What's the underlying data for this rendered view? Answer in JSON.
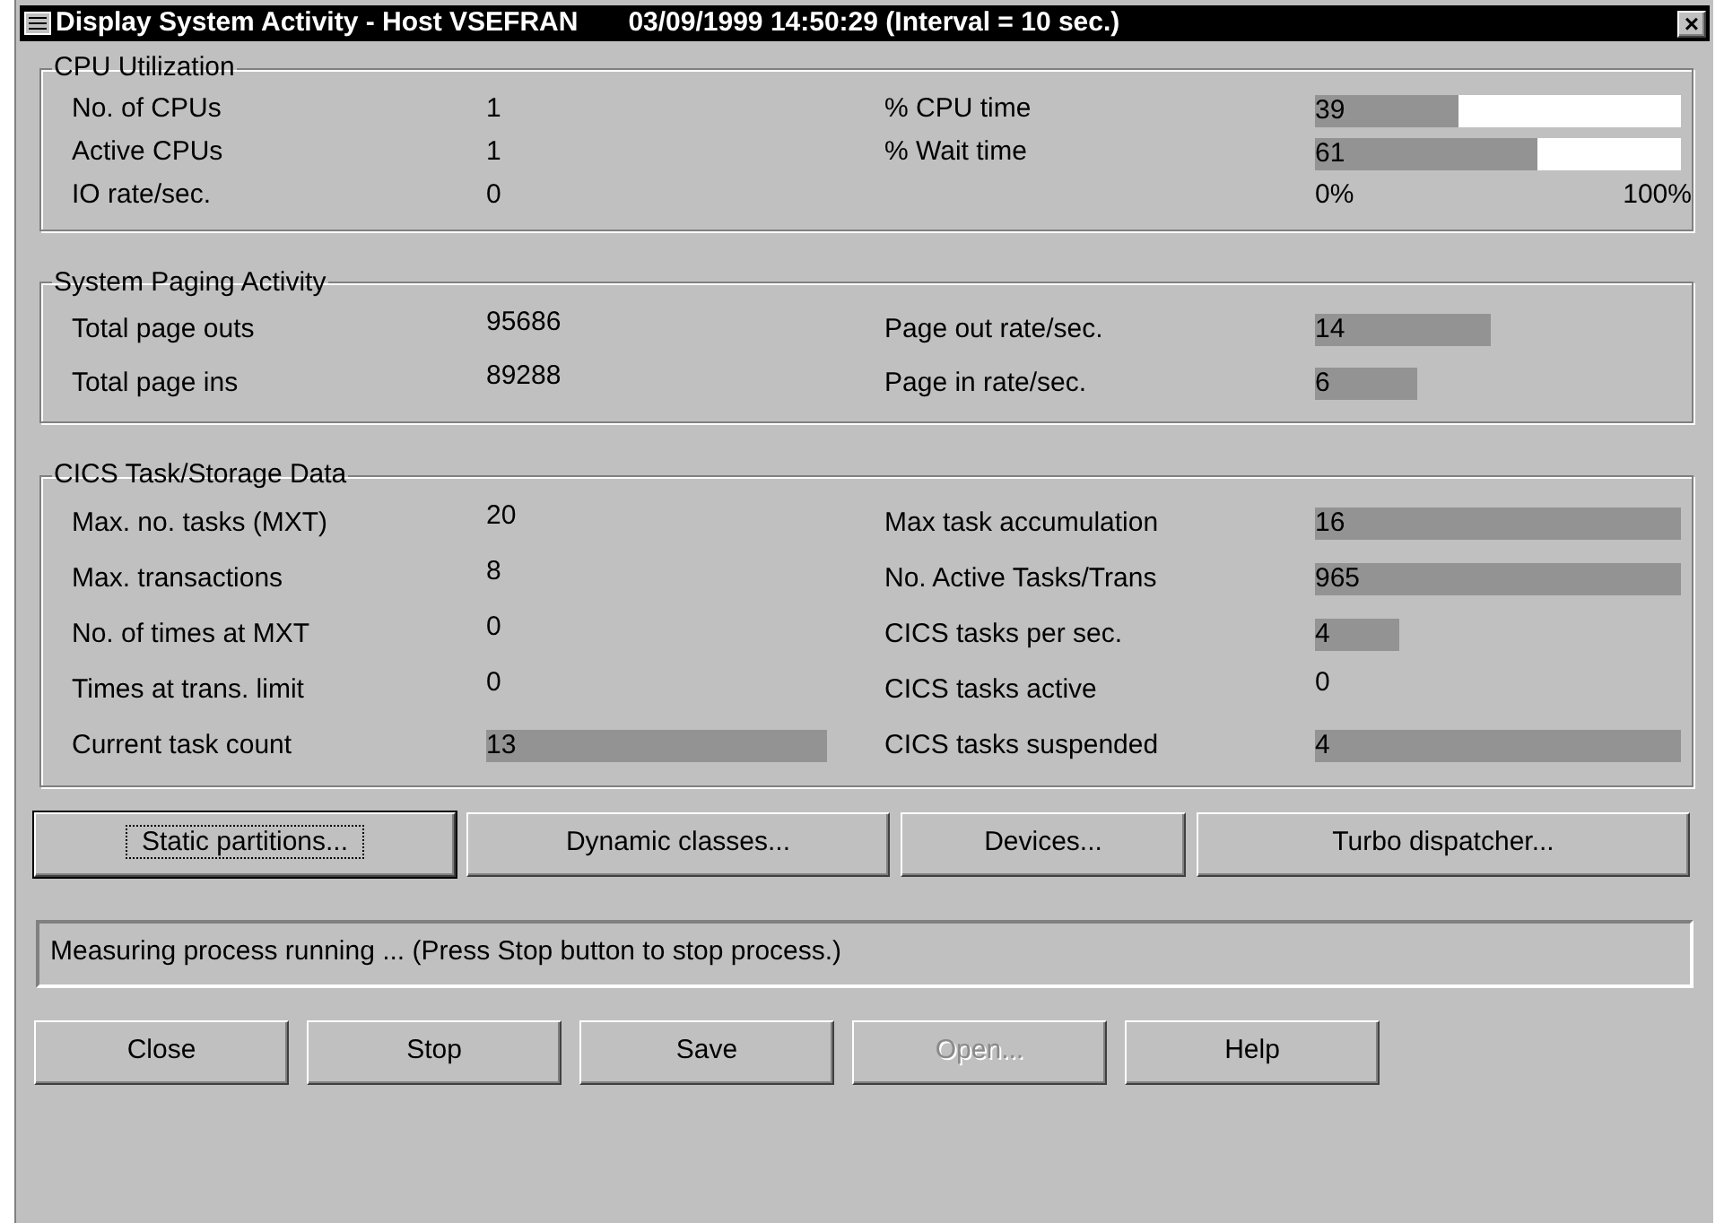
{
  "window": {
    "title": "Display System Activity - Host VSEFRAN",
    "timestamp": "03/09/1999 14:50:29 (Interval = 10 sec.)",
    "close": "×"
  },
  "sections": [
    {
      "title": "CPU Utilization",
      "rows": [
        {
          "label": "No. of CPUs",
          "value": {
            "kind": "text",
            "text": "1"
          },
          "label2": "% CPU time",
          "value2": {
            "kind": "meter",
            "text": "39",
            "level": 0.39
          }
        },
        {
          "label": "Active CPUs",
          "value": {
            "kind": "text",
            "text": "1"
          },
          "label2": "% Wait time",
          "value2": {
            "kind": "meter",
            "text": "61",
            "level": 0.61
          }
        },
        {
          "label": "IO rate/sec.",
          "value": {
            "kind": "text",
            "text": "0"
          },
          "value2": {
            "kind": "scale",
            "min": "0%",
            "max": "100%"
          }
        }
      ]
    },
    {
      "title": "System Paging Activity",
      "rows": [
        {
          "label": "Total page outs",
          "value": {
            "kind": "text",
            "text": "95686"
          },
          "label2": "Page out rate/sec.",
          "value2": {
            "kind": "bar",
            "text": "14"
          }
        },
        {
          "label": "Total page ins",
          "value": {
            "kind": "text",
            "text": "89288"
          },
          "label2": "Page in rate/sec.",
          "value2": {
            "kind": "bar",
            "text": "6"
          }
        }
      ]
    },
    {
      "title": "CICS Task/Storage Data",
      "rows": [
        {
          "label": "Max. no. tasks (MXT)",
          "value": {
            "kind": "text",
            "text": "20"
          },
          "label2": "Max task accumulation",
          "value2": {
            "kind": "bar",
            "text": "16"
          }
        },
        {
          "label": "Max. transactions",
          "value": {
            "kind": "text",
            "text": "8"
          },
          "label2": "No. Active Tasks/Trans",
          "value2": {
            "kind": "bar",
            "text": "965"
          }
        },
        {
          "label": "No. of times at MXT",
          "value": {
            "kind": "text",
            "text": "0"
          },
          "label2": "CICS tasks per sec.",
          "value2": {
            "kind": "bar",
            "text": "4"
          }
        },
        {
          "label": "Times at trans. limit",
          "value": {
            "kind": "text",
            "text": "0"
          },
          "label2": "CICS tasks active",
          "value2": {
            "kind": "text",
            "text": "0"
          }
        },
        {
          "label": "Current task count",
          "value": {
            "kind": "bar",
            "text": "13"
          },
          "label2": "CICS tasks suspended",
          "value2": {
            "kind": "bar",
            "text": "4"
          }
        }
      ]
    }
  ],
  "action_buttons": [
    {
      "label": "Static partitions...",
      "focused": true
    },
    {
      "label": "Dynamic classes...",
      "focused": false
    },
    {
      "label": "Devices...",
      "focused": false
    },
    {
      "label": "Turbo dispatcher...",
      "focused": false
    }
  ],
  "status_bar": "Measuring process running ... (Press Stop button to stop process.)",
  "buttons": [
    {
      "label": "Close",
      "disabled": false
    },
    {
      "label": "Stop",
      "disabled": false
    },
    {
      "label": "Save",
      "disabled": false
    },
    {
      "label": "Open...",
      "disabled": true
    },
    {
      "label": "Help",
      "disabled": false
    }
  ]
}
